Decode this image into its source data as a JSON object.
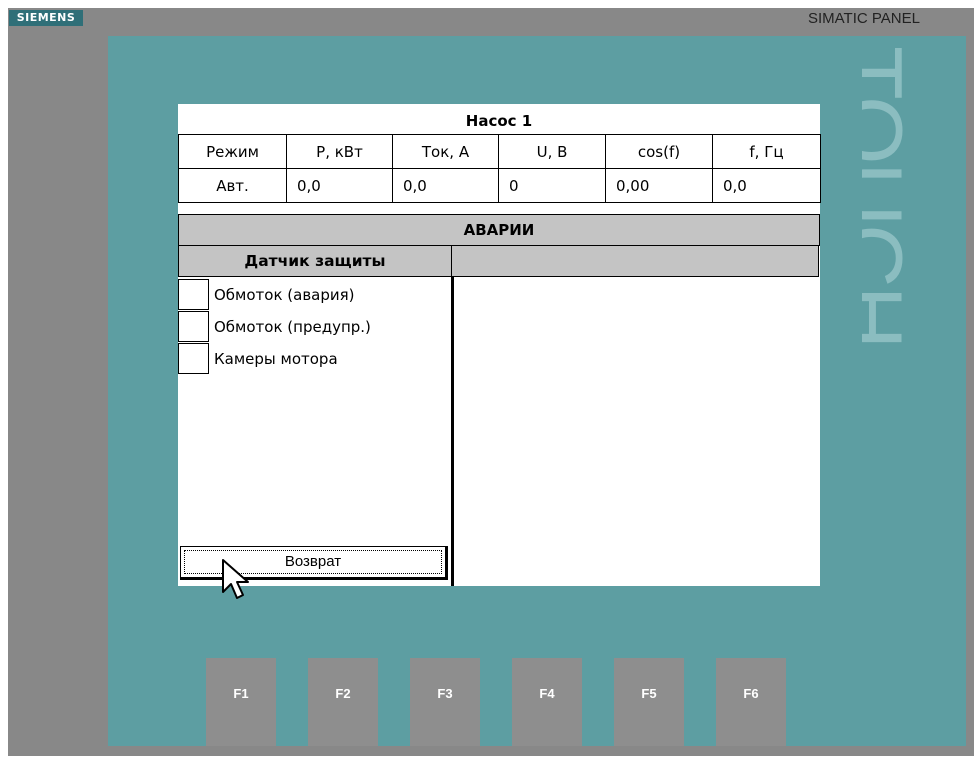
{
  "device": {
    "brand_logo": "SIEMENS",
    "model_label": "SIMATIC PANEL",
    "side_label": "TOUCH",
    "function_keys": [
      "F1",
      "F2",
      "F3",
      "F4",
      "F5",
      "F6"
    ],
    "bezel_color": "#5d9ea2",
    "frame_color": "#888888"
  },
  "screen": {
    "title": "Насос 1",
    "params": {
      "headers": [
        "Режим",
        "P, кВт",
        "Ток, А",
        "U, В",
        "cos(f)",
        "f, Гц"
      ],
      "values": [
        "Авт.",
        "0,0",
        "0,0",
        "0",
        "0,00",
        "0,0"
      ]
    },
    "alarms": {
      "title": "АВАРИИ",
      "sensor_header": "Датчик защиты",
      "sensors": [
        "Обмоток (авария)",
        "Обмоток (предупр.)",
        "Камеры мотора"
      ]
    },
    "return_button": "Возврат"
  }
}
